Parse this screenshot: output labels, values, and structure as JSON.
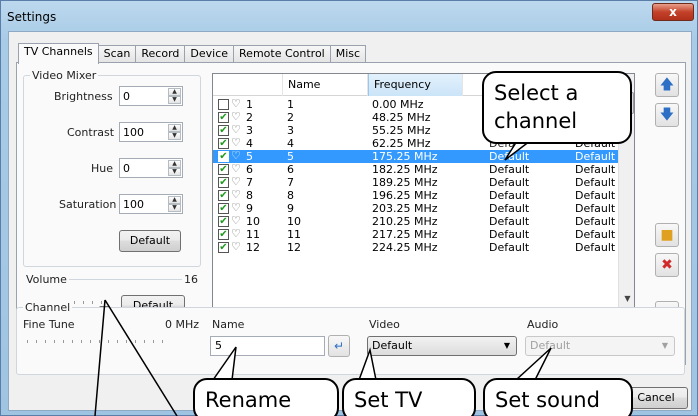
{
  "window": {
    "title": "Settings",
    "close_glyph": "x"
  },
  "tabs": [
    "TV Channels",
    "Scan",
    "Record",
    "Device",
    "Remote Control",
    "Misc"
  ],
  "video_mixer": {
    "label": "Video Mixer",
    "brightness_label": "Brightness",
    "brightness": "0",
    "contrast_label": "Contrast",
    "contrast": "100",
    "hue_label": "Hue",
    "hue": "0",
    "saturation_label": "Saturation",
    "saturation": "100",
    "default_button": "Default"
  },
  "volume": {
    "label": "Volume",
    "value": "16",
    "default_button": "Default",
    "level": 0.9
  },
  "channel_group": {
    "label": "Channel",
    "fine_tune_label": "Fine Tune",
    "fine_tune_value": "0 MHz"
  },
  "list": {
    "columns": [
      "Name",
      "Frequency"
    ],
    "rows": [
      {
        "num": "1",
        "name": "1",
        "freq": "0.00 MHz",
        "video": "",
        "audio": "",
        "checked": false
      },
      {
        "num": "2",
        "name": "2",
        "freq": "48.25 MHz",
        "video": "",
        "audio": "",
        "checked": true
      },
      {
        "num": "3",
        "name": "3",
        "freq": "55.25 MHz",
        "video": "",
        "audio": "",
        "checked": true
      },
      {
        "num": "4",
        "name": "4",
        "freq": "62.25 MHz",
        "video": "",
        "audio": "Default",
        "checked": true
      },
      {
        "num": "5",
        "name": "5",
        "freq": "175.25 MHz",
        "video": "Default",
        "audio": "Default",
        "checked": true,
        "selected": true
      },
      {
        "num": "6",
        "name": "6",
        "freq": "182.25 MHz",
        "video": "Default",
        "audio": "Default",
        "checked": true
      },
      {
        "num": "7",
        "name": "7",
        "freq": "189.25 MHz",
        "video": "Default",
        "audio": "Default",
        "checked": true
      },
      {
        "num": "8",
        "name": "8",
        "freq": "196.25 MHz",
        "video": "Default",
        "audio": "Default",
        "checked": true
      },
      {
        "num": "9",
        "name": "9",
        "freq": "203.25 MHz",
        "video": "Default",
        "audio": "Default",
        "checked": true
      },
      {
        "num": "10",
        "name": "10",
        "freq": "210.25 MHz",
        "video": "Default",
        "audio": "Default",
        "checked": true
      },
      {
        "num": "11",
        "name": "11",
        "freq": "217.25 MHz",
        "video": "Default",
        "audio": "Default",
        "checked": true
      },
      {
        "num": "12",
        "name": "12",
        "freq": "224.25 MHz",
        "video": "Default",
        "audio": "Default",
        "checked": true
      }
    ],
    "partial_video": [
      "D",
      "De",
      "Defa"
    ]
  },
  "fields": {
    "name_label": "Name",
    "name_value": "5",
    "video_label": "Video",
    "video_value": "Default",
    "audio_label": "Audio",
    "audio_value": "Default"
  },
  "cancel_button": "Cancel",
  "callouts": {
    "select": [
      "Select a",
      "channel"
    ],
    "rename": "Rename",
    "set_tv": "Set TV",
    "set_sound": "Set sound"
  },
  "icons": [
    "arrow-up-icon",
    "arrow-down-icon",
    "folder-icon",
    "delete-icon",
    "trash-icon",
    "enter-icon"
  ]
}
